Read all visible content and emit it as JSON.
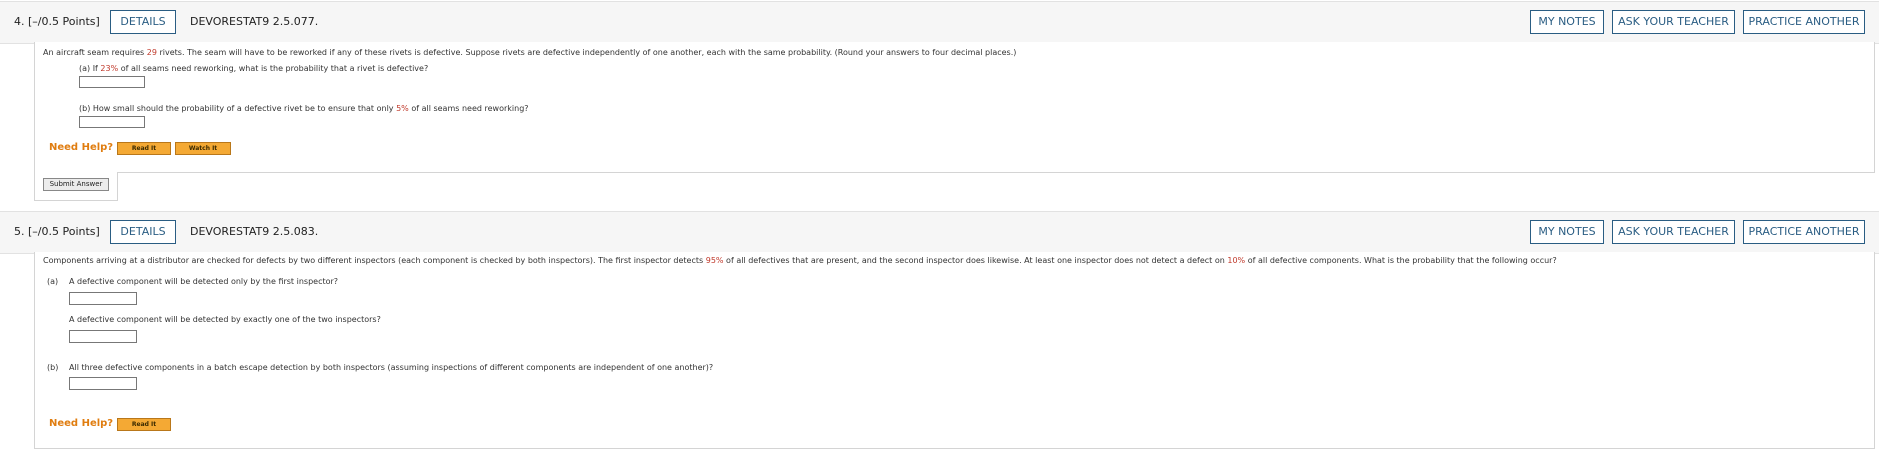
{
  "question4": {
    "number": "4.",
    "points": "[–/0.5 Points]",
    "details_label": "DETAILS",
    "code": "DEVORESTAT9 2.5.077.",
    "my_notes_label": "MY NOTES",
    "ask_teacher_label": "ASK YOUR TEACHER",
    "practice_another_label": "PRACTICE ANOTHER",
    "intro_before": "An aircraft seam requires ",
    "intro_value": "29",
    "intro_after": " rivets. The seam will have to be reworked if any of these rivets is defective. Suppose rivets are defective independently of one another, each with the same probability. (Round your answers to four decimal places.)",
    "part_a_before": "(a) If ",
    "part_a_value": "23%",
    "part_a_after": " of all seams need reworking, what is the probability that a rivet is defective?",
    "part_b_before": "(b) How small should the probability of a defective rivet be to ensure that only ",
    "part_b_value": "5%",
    "part_b_after": " of all seams need reworking?",
    "need_help": "Need Help?",
    "read_it": "Read It",
    "watch_it": "Watch It",
    "submit": "Submit Answer"
  },
  "question5": {
    "number": "5.",
    "points": "[–/0.5 Points]",
    "details_label": "DETAILS",
    "code": "DEVORESTAT9 2.5.083.",
    "my_notes_label": "MY NOTES",
    "ask_teacher_label": "ASK YOUR TEACHER",
    "practice_another_label": "PRACTICE ANOTHER",
    "intro_before": "Components arriving at a distributor are checked for defects by two different inspectors (each component is checked by both inspectors). The first inspector detects ",
    "intro_value1": "95%",
    "intro_middle": " of all defectives that are present, and the second inspector does likewise. At least one inspector does not detect a defect on ",
    "intro_value2": "10%",
    "intro_after": " of all defective components. What is the probability that the following occur?",
    "part_a_label": "(a)",
    "part_a_q1": "A defective component will be detected only by the first inspector?",
    "part_a_q2": "A defective component will be detected by exactly one of the two inspectors?",
    "part_b_label": "(b)",
    "part_b_q": "All three defective components in a batch escape detection by both inspectors (assuming inspections of different components are independent of one another)?",
    "need_help": "Need Help?",
    "read_it": "Read It"
  },
  "colors": {
    "link_blue": "#2a5d83",
    "highlight_red": "#c0392b",
    "need_help_orange": "#e07d10",
    "help_button": "#f4a934"
  }
}
